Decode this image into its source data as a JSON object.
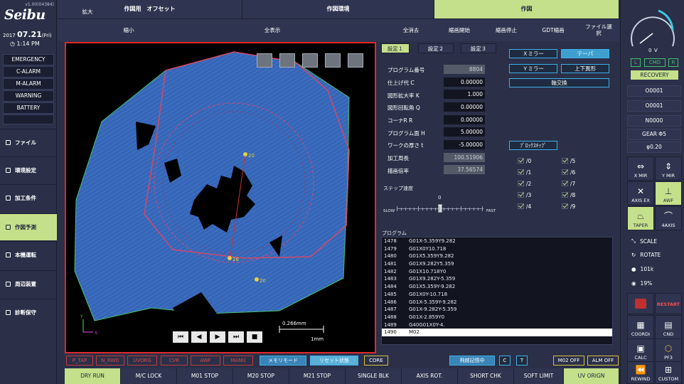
{
  "app": {
    "brand": "Seibu",
    "version": "v1.00(04384)"
  },
  "clock": {
    "year": "2017",
    "date": "07.21",
    "weekday": "(Fri)",
    "time": "1:14 PM"
  },
  "alarms": [
    "EMERGENCY",
    "C-ALARM",
    "M-ALARM",
    "WARNING",
    "BATTERY"
  ],
  "nav": [
    "ファイル",
    "環境設定",
    "加工条件",
    "作図予測",
    "本機運転",
    "周辺装置",
    "診断保守"
  ],
  "top_tabs": [
    "作図用　オフセット",
    "作図環境",
    "作図"
  ],
  "toolbar": [
    "拡大",
    "縮小",
    "全表示",
    "全消去",
    "縮画開始",
    "縮画停止",
    "GDT縮画",
    "ファイル選択"
  ],
  "view": {
    "scale_label": "0.266mm",
    "scale_unit": "1mm",
    "markers": [
      "20",
      "26",
      "20"
    ],
    "axes": [
      "Y",
      "X"
    ]
  },
  "playback": [
    "⏮",
    "◀",
    "▶",
    "⏭",
    "■"
  ],
  "settings_tabs": [
    "設定１",
    "設定２",
    "設定３"
  ],
  "params": [
    {
      "label": "プログラム番号",
      "value": "8804",
      "ro": true
    },
    {
      "label": "仕上げ代 C",
      "value": "0.00000",
      "ro": false
    },
    {
      "label": "図形拡大率 K",
      "value": "1.000",
      "ro": false
    },
    {
      "label": "図形回転角 Q",
      "value": "0.00000",
      "ro": false
    },
    {
      "label": "コーナR R",
      "value": "0.00000",
      "ro": false
    },
    {
      "label": "プログラム面 H",
      "value": "5.00000",
      "ro": false
    },
    {
      "label": "ワークの厚さ t",
      "value": "-5.00000",
      "ro": false
    },
    {
      "label": "加工周長",
      "value": "100.51906",
      "ro": true
    },
    {
      "label": "描画倍率",
      "value": "37.56574",
      "ro": true
    }
  ],
  "mirror_buttons": {
    "xmirror": "Ｘミラー",
    "taper": "テーパ",
    "ymirror": "Ｙミラー",
    "updown": "上下異形",
    "axis_swap": "軸交換",
    "block_skip": "ﾌﾞﾛｯｸｽｷｯﾌﾟ"
  },
  "skips": [
    "/0",
    "/1",
    "/2",
    "/3",
    "/4",
    "/5",
    "/6",
    "/7",
    "/8",
    "/9"
  ],
  "step": {
    "label": "ステップ速度",
    "value": "0",
    "slow": "SLOW",
    "fast": "FAST",
    "level": 0.5
  },
  "program": {
    "label": "プログラム",
    "rows": [
      {
        "n": "1478",
        "code": "G01X-5.359Y9.282"
      },
      {
        "n": "1479",
        "code": "G01X0Y10.718"
      },
      {
        "n": "1480",
        "code": "G01X5.359Y9.282"
      },
      {
        "n": "1481",
        "code": "G01X9.282Y5.359"
      },
      {
        "n": "1482",
        "code": "G01X10.718Y0"
      },
      {
        "n": "1483",
        "code": "G01X9.282Y-5.359"
      },
      {
        "n": "1484",
        "code": "G01X5.359Y-9.282"
      },
      {
        "n": "1485",
        "code": "G01X0Y-10.718"
      },
      {
        "n": "1486",
        "code": "G01X-5.359Y-9.282"
      },
      {
        "n": "1487",
        "code": "G01X-9.282Y-5.359"
      },
      {
        "n": "1488",
        "code": "G01X-2.859Y0"
      },
      {
        "n": "1489",
        "code": "G40G01X0Y-4."
      },
      {
        "n": "1490",
        "code": "M02"
      }
    ]
  },
  "status_buttons": [
    "P_TAP",
    "N_RWD",
    "UVORG",
    "CVR",
    "AWF",
    "MANU"
  ],
  "mode_buttons": {
    "memory": "メモリモード",
    "reset": "リセット状態",
    "core": "CORE",
    "jump": "飛越記憶中",
    "c": "C",
    "t": "T",
    "m02off": "M02 OFF",
    "almoff": "ALM OFF"
  },
  "bottom": [
    "DRY RUN",
    "M/C LOCK",
    "M01 STOP",
    "M20 STOP",
    "M21 STOP",
    "SINGLE BLK",
    "AXIS ROT.",
    "SHORT CHK",
    "SOFT LIMIT",
    "UV ORIGN"
  ],
  "gauge": {
    "value": "0",
    "unit": "V"
  },
  "indicators": [
    "L",
    "CMD",
    "R"
  ],
  "recovery": "RECOVERY",
  "info": [
    "O0001",
    "O0001",
    "N0000",
    "GEAR Φ5",
    "φ0.20"
  ],
  "mirror_icons": [
    "X MIR",
    "Y MIR",
    "AXIS EX",
    "AWF",
    "TAPER",
    "4AXIS"
  ],
  "sub": {
    "scale": "SCALE",
    "rotate": "ROTATE",
    "flow": "101k",
    "pct": "19%"
  },
  "func": [
    "RESTART",
    "COORDI",
    "CND",
    "CALC",
    "PF3",
    "REWIND",
    "CUSTOM"
  ]
}
